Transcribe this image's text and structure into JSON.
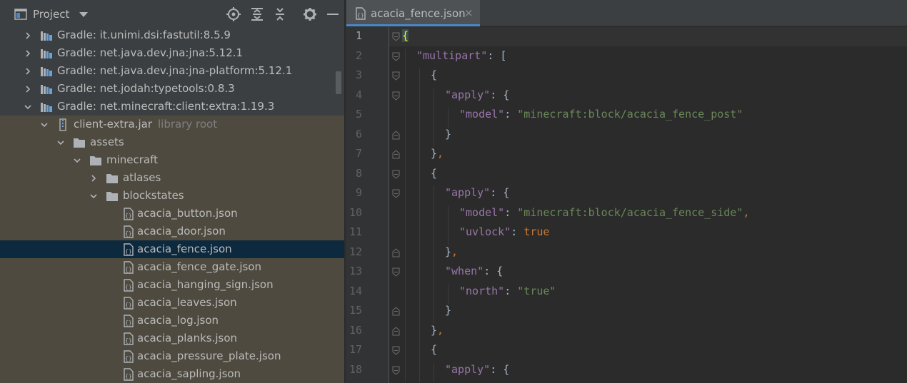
{
  "project_panel": {
    "title": "Project",
    "tree": [
      {
        "label": "Gradle: it.unimi.dsi:fastutil:8.5.9",
        "kind": "library",
        "expanded": false,
        "depth": 1
      },
      {
        "label": "Gradle: net.java.dev.jna:jna:5.12.1",
        "kind": "library",
        "expanded": false,
        "depth": 1
      },
      {
        "label": "Gradle: net.java.dev.jna:jna-platform:5.12.1",
        "kind": "library",
        "expanded": false,
        "depth": 1
      },
      {
        "label": "Gradle: net.jodah:typetools:0.8.3",
        "kind": "library",
        "expanded": false,
        "depth": 1
      },
      {
        "label": "Gradle: net.minecraft:client:extra:1.19.3",
        "kind": "library",
        "expanded": true,
        "depth": 1
      },
      {
        "label": "client-extra.jar",
        "sublabel": "library root",
        "kind": "jar",
        "expanded": true,
        "depth": 2
      },
      {
        "label": "assets",
        "kind": "folder",
        "expanded": true,
        "depth": 3
      },
      {
        "label": "minecraft",
        "kind": "folder",
        "expanded": true,
        "depth": 4
      },
      {
        "label": "atlases",
        "kind": "folder",
        "expanded": false,
        "depth": 5
      },
      {
        "label": "blockstates",
        "kind": "folder",
        "expanded": true,
        "depth": 5
      },
      {
        "label": "acacia_button.json",
        "kind": "json",
        "depth": 6
      },
      {
        "label": "acacia_door.json",
        "kind": "json",
        "depth": 6
      },
      {
        "label": "acacia_fence.json",
        "kind": "json",
        "depth": 6,
        "selected": true
      },
      {
        "label": "acacia_fence_gate.json",
        "kind": "json",
        "depth": 6
      },
      {
        "label": "acacia_hanging_sign.json",
        "kind": "json",
        "depth": 6
      },
      {
        "label": "acacia_leaves.json",
        "kind": "json",
        "depth": 6
      },
      {
        "label": "acacia_log.json",
        "kind": "json",
        "depth": 6
      },
      {
        "label": "acacia_planks.json",
        "kind": "json",
        "depth": 6
      },
      {
        "label": "acacia_pressure_plate.json",
        "kind": "json",
        "depth": 6
      },
      {
        "label": "acacia_sapling.json",
        "kind": "json",
        "depth": 6
      }
    ]
  },
  "editor": {
    "tab_label": "acacia_fence.json",
    "tab_close": "×",
    "lines": [
      {
        "n": "1",
        "indent": 0,
        "tokens": [
          [
            "b",
            "{"
          ]
        ]
      },
      {
        "n": "2",
        "indent": 1,
        "tokens": [
          [
            "k",
            "\"multipart\""
          ],
          [
            "p",
            ": ["
          ]
        ]
      },
      {
        "n": "3",
        "indent": 2,
        "tokens": [
          [
            "p",
            "{"
          ]
        ]
      },
      {
        "n": "4",
        "indent": 3,
        "tokens": [
          [
            "k",
            "\"apply\""
          ],
          [
            "p",
            ": {"
          ]
        ]
      },
      {
        "n": "5",
        "indent": 4,
        "tokens": [
          [
            "k",
            "\"model\""
          ],
          [
            "p",
            ": "
          ],
          [
            "s",
            "\"minecraft:block/acacia_fence_post\""
          ]
        ]
      },
      {
        "n": "6",
        "indent": 3,
        "tokens": [
          [
            "p",
            "}"
          ]
        ]
      },
      {
        "n": "7",
        "indent": 2,
        "tokens": [
          [
            "p",
            "}"
          ],
          [
            "kw",
            ","
          ]
        ]
      },
      {
        "n": "8",
        "indent": 2,
        "tokens": [
          [
            "p",
            "{"
          ]
        ]
      },
      {
        "n": "9",
        "indent": 3,
        "tokens": [
          [
            "k",
            "\"apply\""
          ],
          [
            "p",
            ": {"
          ]
        ]
      },
      {
        "n": "10",
        "indent": 4,
        "tokens": [
          [
            "k",
            "\"model\""
          ],
          [
            "p",
            ": "
          ],
          [
            "s",
            "\"minecraft:block/acacia_fence_side\""
          ],
          [
            "kw",
            ","
          ]
        ]
      },
      {
        "n": "11",
        "indent": 4,
        "tokens": [
          [
            "k",
            "\"uvlock\""
          ],
          [
            "p",
            ": "
          ],
          [
            "kw",
            "true"
          ]
        ]
      },
      {
        "n": "12",
        "indent": 3,
        "tokens": [
          [
            "p",
            "}"
          ],
          [
            "kw",
            ","
          ]
        ]
      },
      {
        "n": "13",
        "indent": 3,
        "tokens": [
          [
            "k",
            "\"when\""
          ],
          [
            "p",
            ": {"
          ]
        ]
      },
      {
        "n": "14",
        "indent": 4,
        "tokens": [
          [
            "k",
            "\"north\""
          ],
          [
            "p",
            ": "
          ],
          [
            "s",
            "\"true\""
          ]
        ]
      },
      {
        "n": "15",
        "indent": 3,
        "tokens": [
          [
            "p",
            "}"
          ]
        ]
      },
      {
        "n": "16",
        "indent": 2,
        "tokens": [
          [
            "p",
            "}"
          ],
          [
            "kw",
            ","
          ]
        ]
      },
      {
        "n": "17",
        "indent": 2,
        "tokens": [
          [
            "p",
            "{"
          ]
        ]
      },
      {
        "n": "18",
        "indent": 3,
        "tokens": [
          [
            "k",
            "\"apply\""
          ],
          [
            "p",
            ": {"
          ]
        ]
      }
    ]
  },
  "icons": {
    "project_view": "project-window-icon",
    "locate": "crosshair-icon",
    "expand_all": "expand-all-icon",
    "collapse_all": "collapse-all-icon",
    "settings": "gear-icon",
    "hide": "minimize-icon"
  },
  "colors": {
    "selection": "#0d293e",
    "library_root_bg": "#4e4a3f",
    "tab_underline": "#4a88c7",
    "json_key": "#9876aa",
    "json_string": "#6a8759",
    "json_keyword": "#cc7832"
  }
}
